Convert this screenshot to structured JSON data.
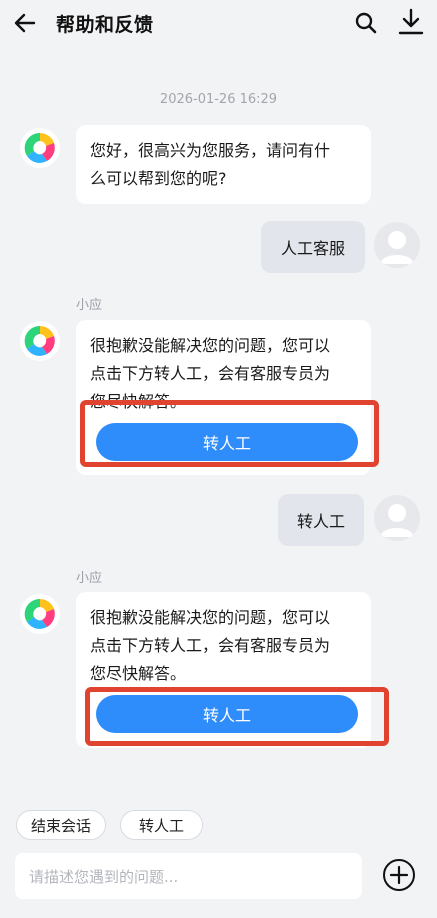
{
  "header": {
    "title": "帮助和反馈",
    "back_icon": "arrow-left-icon",
    "search_icon": "search-icon",
    "download_icon": "download-icon"
  },
  "chat": {
    "timestamp": "2026-01-26 16:29",
    "messages": [
      {
        "from": "bot",
        "lines": [
          "您好，很高兴为您服务，请问有什",
          "么可以帮到您的呢?"
        ]
      },
      {
        "from": "user",
        "text": "人工客服"
      },
      {
        "from": "bot",
        "sender": "小应",
        "lines": [
          "很抱歉没能解决您的问题，您可以",
          "点击下方转人工，会有客服专员为",
          "您尽快解答。"
        ],
        "button": "转人工"
      },
      {
        "from": "user",
        "text": "转人工"
      },
      {
        "from": "bot",
        "sender": "小应",
        "lines": [
          "很抱歉没能解决您的问题，您可以",
          "点击下方转人工，会有客服专员为",
          "您尽快解答。"
        ],
        "button": "转人工"
      }
    ]
  },
  "quick_replies": [
    "结束会话",
    "转人工"
  ],
  "composer": {
    "placeholder": "请描述您遇到的问题...",
    "add_icon": "plus-circle-icon"
  },
  "colors": {
    "accent": "#2f8cfb",
    "highlight": "#e0432f",
    "background": "#f2f3f5"
  }
}
